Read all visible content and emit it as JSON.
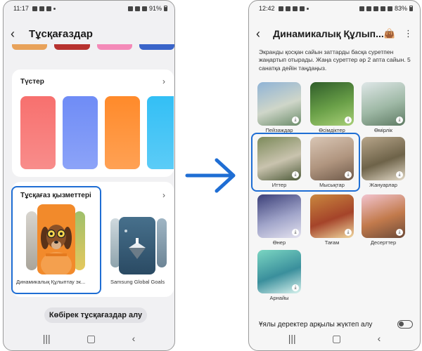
{
  "left_phone": {
    "status": {
      "time": "11:17",
      "battery": "91%"
    },
    "title": "Тұсқағаздар",
    "colors_section": {
      "label": "Түстер",
      "swatches": [
        "#f7706e",
        "#6f8cf6",
        "#ff8a2a",
        "#33bff5"
      ]
    },
    "services_section": {
      "label": "Тұсқағаз қызметтері",
      "items": [
        {
          "caption": "Динамикалық Құлыптау эк..."
        },
        {
          "caption": "Samsung Global Goals"
        }
      ]
    },
    "more_button": "Көбірек тұсқағаздар алу"
  },
  "right_phone": {
    "status": {
      "time": "12:42",
      "battery": "83%"
    },
    "title": "Динамикалық Құлып...",
    "description": "Экранды қосқан сайын заттарды басқа суретпен жаңартып отырады. Жаңа суреттер әр 2 апта сайын. 5 санатқа дейін таңдаңыз.",
    "categories": [
      {
        "label": "Пейзаждар",
        "palette": [
          "#8fb3d6",
          "#cfd6c9",
          "#6b8c6a"
        ]
      },
      {
        "label": "Өсімдіктер",
        "palette": [
          "#2f5d2a",
          "#6aa048",
          "#a8cf78"
        ]
      },
      {
        "label": "Өмірлік",
        "palette": [
          "#dfe7e8",
          "#9fb9a6",
          "#5e7a63"
        ]
      },
      {
        "label": "Иттер",
        "palette": [
          "#7c8a5a",
          "#c9c3ae",
          "#4e5b3a"
        ]
      },
      {
        "label": "Мысықтар",
        "palette": [
          "#d9c6b5",
          "#b0957f",
          "#6f5a4a"
        ]
      },
      {
        "label": "Жануарлар",
        "palette": [
          "#b7a58a",
          "#6e6349",
          "#e3dac8"
        ]
      },
      {
        "label": "Өнер",
        "palette": [
          "#3b3f78",
          "#a0a4c9",
          "#e4e2ef"
        ]
      },
      {
        "label": "Тағам",
        "palette": [
          "#c9873e",
          "#a5442a",
          "#f0d8a0"
        ]
      },
      {
        "label": "Десерттер",
        "palette": [
          "#f2c4cf",
          "#c27a4c",
          "#6d4a38"
        ]
      },
      {
        "label": "Арнайы",
        "palette": [
          "#7bd6c2",
          "#3a8f9c",
          "#d9f3ee"
        ]
      }
    ],
    "mobile_data_toggle": {
      "label": "Ұялы деректер арқылы жүктеп алу",
      "on": false
    }
  },
  "accent_color": "#1f6ed4"
}
